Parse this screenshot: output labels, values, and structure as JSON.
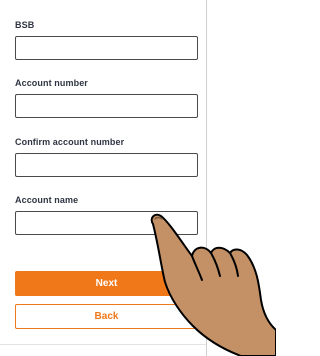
{
  "form": {
    "fields": [
      {
        "label": "BSB",
        "value": ""
      },
      {
        "label": "Account number",
        "value": ""
      },
      {
        "label": "Confirm account number",
        "value": ""
      },
      {
        "label": "Account name",
        "value": ""
      }
    ],
    "next_label": "Next",
    "back_label": "Back"
  },
  "colors": {
    "accent": "#f07818",
    "label_text": "#2f3542",
    "field_border": "#4a4a4a",
    "hand_skin": "#c49166"
  },
  "icons": {
    "hand": "pointing-hand-icon"
  }
}
